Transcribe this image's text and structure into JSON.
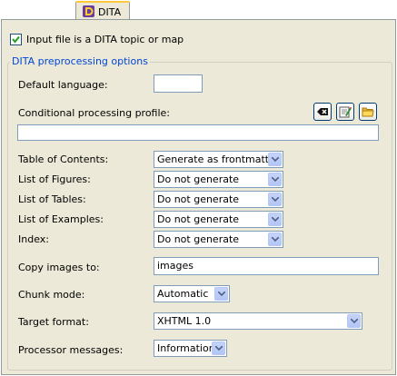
{
  "tab": {
    "label": "DITA"
  },
  "input_checkbox": {
    "label": "Input file is a DITA topic or map",
    "checked": true
  },
  "group": {
    "title": "DITA preprocessing options",
    "default_language": {
      "label": "Default language:",
      "value": ""
    },
    "profile": {
      "label": "Conditional processing profile:",
      "value": "",
      "buttons": [
        "clear-icon",
        "edit-icon",
        "folder-icon"
      ]
    },
    "toc": {
      "label": "Table of Contents:",
      "value": "Generate as frontmatter"
    },
    "figures": {
      "label": "List of Figures:",
      "value": "Do not generate"
    },
    "tables": {
      "label": "List of Tables:",
      "value": "Do not generate"
    },
    "examples": {
      "label": "List of Examples:",
      "value": "Do not generate"
    },
    "index": {
      "label": "Index:",
      "value": "Do not generate"
    },
    "copy_images": {
      "label": "Copy images to:",
      "value": "images"
    },
    "chunk": {
      "label": "Chunk mode:",
      "value": "Automatic"
    },
    "target": {
      "label": "Target format:",
      "value": "XHTML 1.0"
    },
    "messages": {
      "label": "Processor messages:",
      "value": "Information"
    }
  }
}
